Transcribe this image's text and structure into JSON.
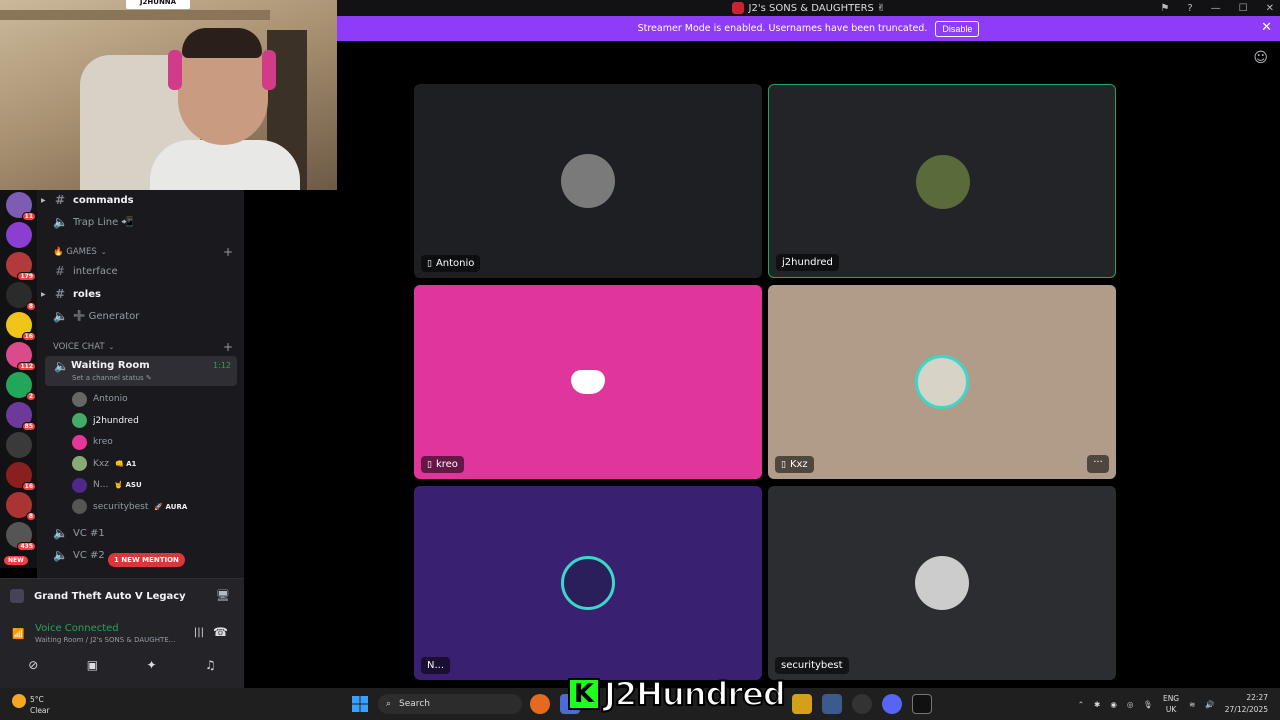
{
  "window": {
    "title": "J2's SONS & DAUGHTERS ✌"
  },
  "banner": {
    "message": "Streamer Mode is enabled. Usernames have been truncated.",
    "disable_label": "Disable",
    "close": "✕"
  },
  "webcam": {
    "sign_text": "J2HUNNA"
  },
  "servers": [
    {
      "badge": "11",
      "color": "#7d5cb4"
    },
    {
      "badge": "",
      "color": "#8a3fd1"
    },
    {
      "badge": "179",
      "color": "#b33a3a"
    },
    {
      "badge": "8",
      "color": "#2b2b2b"
    },
    {
      "badge": "16",
      "color": "#f0c419"
    },
    {
      "badge": "112",
      "color": "#d94b8a"
    },
    {
      "badge": "2",
      "color": "#23a55a"
    },
    {
      "badge": "85",
      "color": "#6d3a9c"
    },
    {
      "badge": "",
      "color": "#3a3a3a"
    },
    {
      "badge": "16",
      "color": "#8a1f1f"
    },
    {
      "badge": "8",
      "color": "#a33"
    },
    {
      "badge": "435",
      "color": "#555"
    }
  ],
  "server_new_label": "NEW",
  "channels": {
    "commands": "commands",
    "trap_line": "Trap Line 📲",
    "games_category": "🔥 GAMES",
    "interface": "interface",
    "roles": "roles",
    "generator": "➕ Generator",
    "voice_category": "VOICE CHAT",
    "waiting_room": {
      "name": "Waiting Room",
      "status": "Set a channel status ✎",
      "timer": "1:12"
    },
    "members": [
      {
        "name": "Antonio",
        "tag": "",
        "color": "#666",
        "bold": false
      },
      {
        "name": "j2hundred",
        "tag": "",
        "color": "#4a6",
        "bold": true
      },
      {
        "name": "kreo",
        "tag": "",
        "color": "#e6369a",
        "bold": false
      },
      {
        "name": "Kxz",
        "tag": "👊 A1",
        "color": "#8a7",
        "bold": false
      },
      {
        "name": "N...",
        "tag": "🤘 ASU",
        "color": "#4b2a8a",
        "bold": false
      },
      {
        "name": "securitybest",
        "tag": "🚀 AURA",
        "color": "#555",
        "bold": false
      }
    ],
    "vc1": "VC #1",
    "vc2": "VC #2",
    "mention": "1 NEW MENTION"
  },
  "panel": {
    "game": "Grand Theft Auto V Legacy",
    "voice_status": "Voice Connected",
    "voice_sub": "Waiting Room / J2's SONS & DAUGHTE..."
  },
  "tiles": [
    {
      "name": "Antonio",
      "mobile": true,
      "bg": "#1e1f22",
      "avatar": "#7a7a7a"
    },
    {
      "name": "j2hundred",
      "mobile": false,
      "bg": "#232428",
      "avatar": "#5a6a3a"
    },
    {
      "name": "kreo",
      "mobile": true,
      "bg": "#e0359a",
      "avatar": ""
    },
    {
      "name": "Kxz",
      "mobile": true,
      "bg": "#b09c89",
      "avatar": "#d8d3c7"
    },
    {
      "name": "N...",
      "mobile": false,
      "bg": "#3a2070",
      "avatar": "#2a1f5a"
    },
    {
      "name": "securitybest",
      "mobile": false,
      "bg": "#2b2d31",
      "avatar": "#ccc"
    }
  ],
  "taskbar": {
    "temp": "5°C",
    "weather": "Clear",
    "search_placeholder": "Search",
    "lang": "ENG",
    "region": "UK",
    "time": "22:27",
    "date": "27/12/2025"
  },
  "watermark": {
    "k": "K",
    "text": "J2Hundred"
  }
}
